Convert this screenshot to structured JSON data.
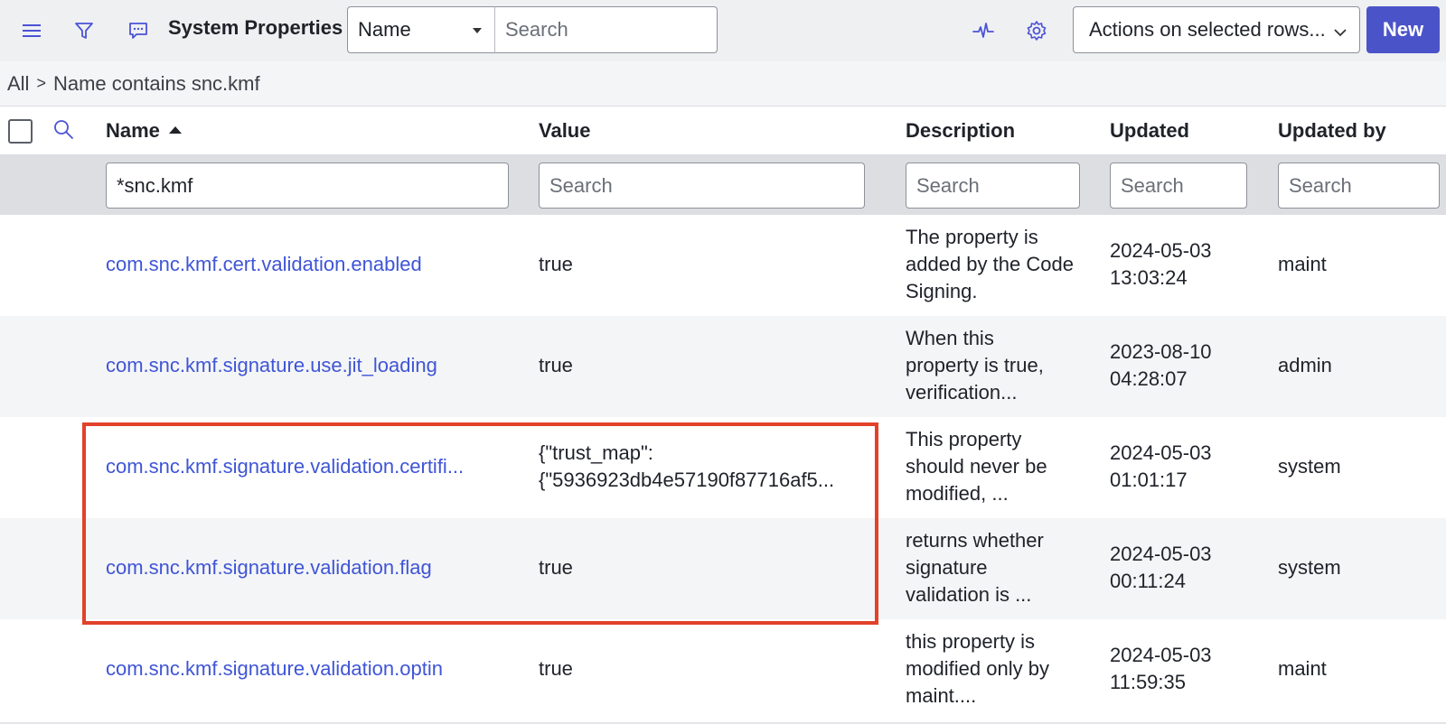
{
  "header": {
    "title": "System Properties",
    "field_select": "Name",
    "search_placeholder": "Search",
    "actions_label": "Actions on selected rows...",
    "new_label": "New",
    "icons": [
      "menu-icon",
      "filter-icon",
      "chat-icon",
      "activity-icon",
      "gear-icon"
    ]
  },
  "breadcrumb": {
    "all": "All",
    "separator": ">",
    "condition": "Name contains snc.kmf"
  },
  "columns": [
    "Name",
    "Value",
    "Description",
    "Updated",
    "Updated by"
  ],
  "filters": {
    "name": "*snc.kmf",
    "value_placeholder": "Search",
    "description_placeholder": "Search",
    "updated_placeholder": "Search",
    "updated_by_placeholder": "Search"
  },
  "rows": [
    {
      "name": "com.snc.kmf.cert.validation.enabled",
      "value": [
        "true"
      ],
      "description": [
        "The property is",
        "added by the Code",
        "Signing."
      ],
      "updated": [
        "2024-05-03",
        "13:03:24"
      ],
      "updated_by": "maint"
    },
    {
      "name": "com.snc.kmf.signature.use.jit_loading",
      "value": [
        "true"
      ],
      "description": [
        "When this",
        "property is true,",
        "verification..."
      ],
      "updated": [
        "2023-08-10",
        "04:28:07"
      ],
      "updated_by": "admin"
    },
    {
      "name": "com.snc.kmf.signature.validation.certifi...",
      "value": [
        "{\"trust_map\":",
        "{\"5936923db4e57190f87716af5..."
      ],
      "description": [
        "This property",
        "should never be",
        "modified, ..."
      ],
      "updated": [
        "2024-05-03",
        "01:01:17"
      ],
      "updated_by": "system"
    },
    {
      "name": "com.snc.kmf.signature.validation.flag",
      "value": [
        "true"
      ],
      "description": [
        "returns whether",
        "signature",
        "validation is ..."
      ],
      "updated": [
        "2024-05-03",
        "00:11:24"
      ],
      "updated_by": "system"
    },
    {
      "name": "com.snc.kmf.signature.validation.optin",
      "value": [
        "true"
      ],
      "description": [
        "this property is",
        "modified only by",
        "maint...."
      ],
      "updated": [
        "2024-05-03",
        "11:59:35"
      ],
      "updated_by": "maint"
    }
  ],
  "colors": {
    "accent": "#4b53c9",
    "link": "#3f55d6",
    "highlight": "#e2412a"
  }
}
